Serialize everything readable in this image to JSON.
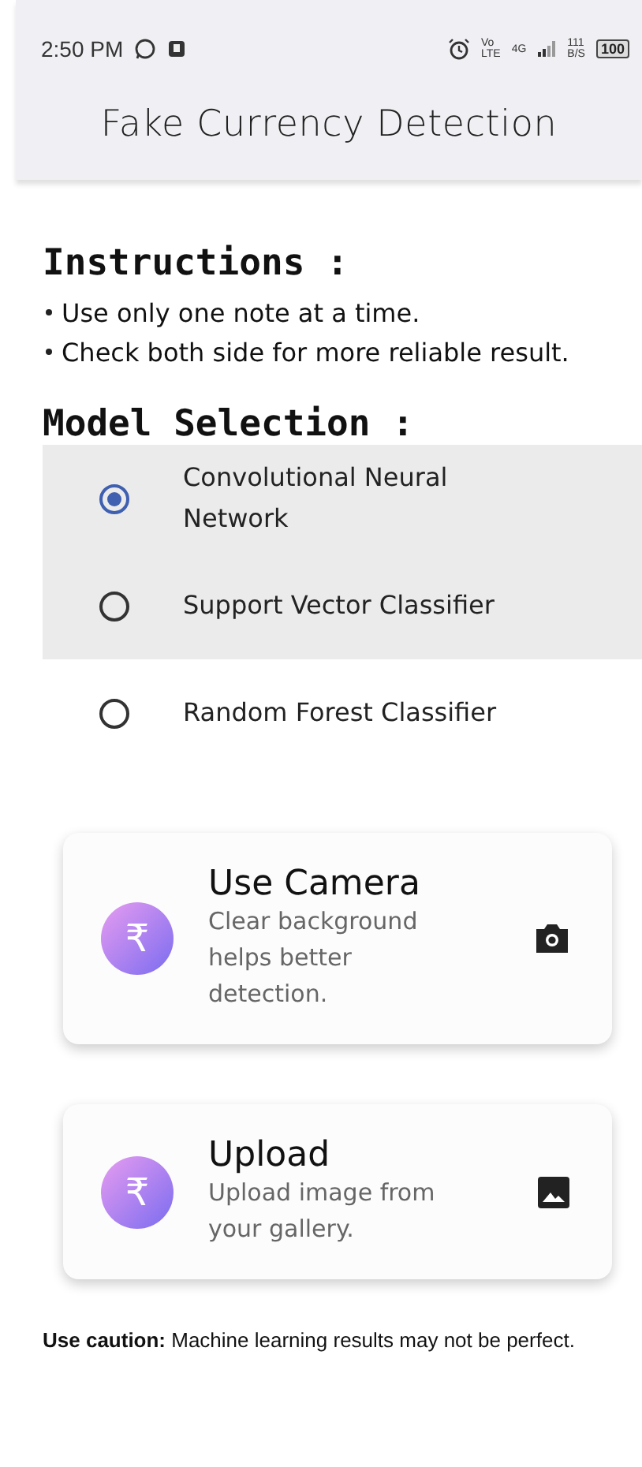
{
  "status_bar": {
    "time": "2:50 PM",
    "network_labels": [
      "Vo",
      "LTE",
      "4G",
      "111",
      "B/S"
    ],
    "battery": "100"
  },
  "app_bar": {
    "title": "Fake Currency Detection"
  },
  "instructions": {
    "heading": "Instructions :",
    "items": [
      "Use only one note at a time.",
      "Check both side for more reliable result."
    ]
  },
  "model_selection": {
    "heading": "Model Selection :",
    "options": [
      {
        "label": "Convolutional Neural Network",
        "selected": true,
        "highlighted": true
      },
      {
        "label": "Support Vector Classifier",
        "selected": false,
        "highlighted": true
      },
      {
        "label": "Random Forest Classifier",
        "selected": false,
        "highlighted": false
      }
    ]
  },
  "actions": [
    {
      "title": "Use Camera",
      "subtitle": "Clear background helps better detection.",
      "badge": "₹",
      "kind": "camera"
    },
    {
      "title": "Upload",
      "subtitle": "Upload image from your gallery.",
      "badge": "₹",
      "kind": "gallery"
    }
  ],
  "caution": "**Use caution:** Machine learning results may not be perfect."
}
